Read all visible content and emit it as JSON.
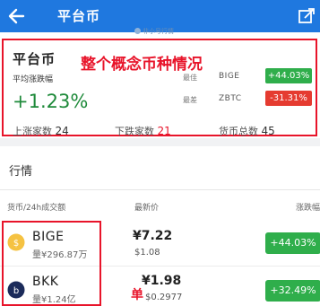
{
  "header": {
    "title": "平台币",
    "back_icon": "arrow-left-icon",
    "share_icon": "share-icon",
    "bg_color": "#1f78df"
  },
  "watermark": "非小号行情",
  "summary": {
    "coin_name": "平台币",
    "avg_label": "平均涨跌幅",
    "avg_value": "+1.23%",
    "annotation": "整个概念币种情况",
    "highest": {
      "label": "最佳",
      "symbol": "BIGE",
      "change": "+44.03%",
      "color": "#2fae4b"
    },
    "lowest": {
      "label": "最差",
      "symbol": "ZBTC",
      "change": "-31.31%",
      "color": "#e53b30"
    },
    "stats": {
      "up_label": "上涨家数",
      "up_count": "24",
      "down_label": "下跌家数",
      "down_count": "21",
      "total_label": "货币总数",
      "total_count": "45"
    }
  },
  "market": {
    "title": "行情",
    "columns": {
      "coin": "货币/24h成交额",
      "price": "最新价",
      "change": "涨跌幅"
    },
    "rows": [
      {
        "name": "BIGE",
        "volume": "量¥296.87万",
        "price": "¥7.22",
        "usd": "$1.08",
        "change": "+44.03%",
        "icon": "bige-coin-icon"
      },
      {
        "name": "BKK",
        "volume": "量¥1.24亿",
        "price": "¥1.98",
        "usd": "$0.2977",
        "change": "+32.49%",
        "icon": "bkk-coin-icon"
      }
    ],
    "red_mark": "单"
  }
}
